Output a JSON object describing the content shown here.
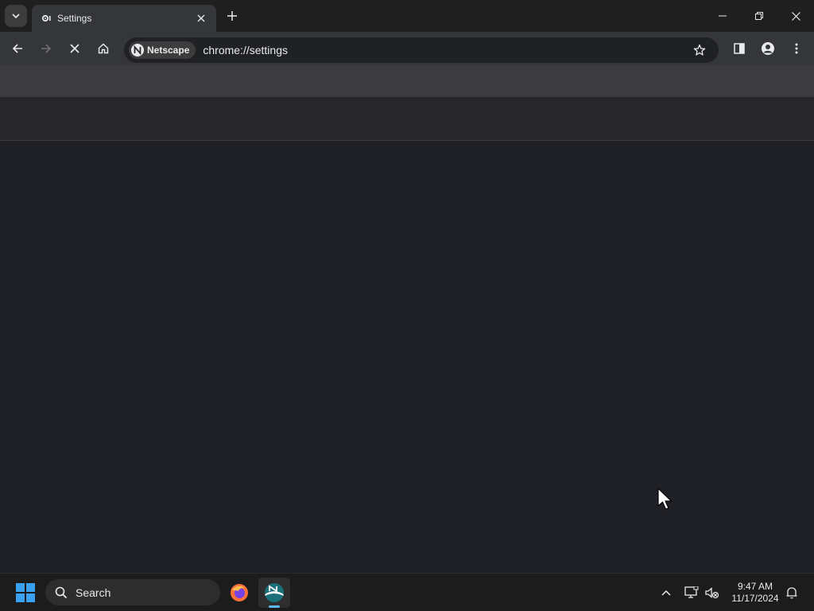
{
  "browser": {
    "tab": {
      "title": "Settings"
    },
    "omnibox": {
      "chip_label": "Netscape",
      "url": "chrome://settings"
    }
  },
  "taskbar": {
    "search_label": "Search",
    "clock": {
      "time": "9:47 AM",
      "date": "11/17/2024"
    }
  },
  "colors": {
    "tabstrip": "#1f1f1f",
    "toolbar": "#35363a",
    "page_background": "#202027",
    "taskbar": "#1c1c1c",
    "windows_accent": "#3aa0f0"
  },
  "icons": [
    "tab-search-icon",
    "settings-gear-icon",
    "close-icon",
    "plus-icon",
    "minimize-icon",
    "restore-icon",
    "back-arrow-icon",
    "forward-arrow-icon",
    "stop-icon",
    "home-icon",
    "netscape-logo-icon",
    "star-icon",
    "side-panel-icon",
    "profile-icon",
    "more-vert-icon",
    "windows-logo-icon",
    "search-icon",
    "firefox-icon",
    "netscape-app-icon",
    "chevron-up-icon",
    "network-icon",
    "volume-muted-icon",
    "notification-bell-icon",
    "mouse-cursor"
  ]
}
